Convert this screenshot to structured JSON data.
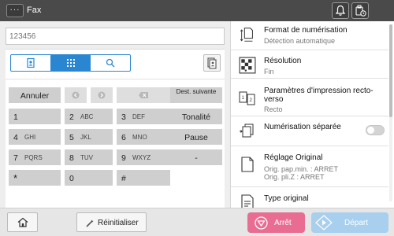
{
  "header": {
    "menu_label": "···",
    "title": "Fax",
    "icons": [
      "bell-icon",
      "device-status-icon"
    ]
  },
  "destination": {
    "value": "123456",
    "tabs": [
      "address-book-icon",
      "keypad-icon",
      "search-icon"
    ],
    "active_tab": "keypad-icon",
    "book_icon": "address-book-icon"
  },
  "keypad": {
    "cancel": "Annuler",
    "dest_next": "Dest. suivante",
    "keys": [
      {
        "num": "1",
        "letters": ""
      },
      {
        "num": "2",
        "letters": "ABC"
      },
      {
        "num": "3",
        "letters": "DEF"
      },
      {
        "num": "4",
        "letters": "GHI"
      },
      {
        "num": "5",
        "letters": "JKL"
      },
      {
        "num": "6",
        "letters": "MNO"
      },
      {
        "num": "7",
        "letters": "PQRS"
      },
      {
        "num": "8",
        "letters": "TUV"
      },
      {
        "num": "9",
        "letters": "WXYZ"
      },
      {
        "num": "*",
        "letters": ""
      },
      {
        "num": "0",
        "letters": ""
      },
      {
        "num": "#",
        "letters": ""
      }
    ],
    "tone": "Tonalité",
    "pause": "Pause",
    "dash": "-"
  },
  "settings": [
    {
      "title": "Format de numérisation",
      "subtitle": "Détection automatique",
      "icon": "scan-size-icon"
    },
    {
      "title": "Résolution",
      "subtitle": "Fin",
      "icon": "resolution-icon"
    },
    {
      "title": "Paramètres d'impression recto-verso",
      "subtitle": "Recto",
      "icon": "duplex-icon"
    },
    {
      "title": "Numérisation séparée",
      "subtitle": "",
      "icon": "separate-scan-icon",
      "toggle": false
    },
    {
      "title": "Réglage Original",
      "subtitle": "Orig. pap.min. : ARRET",
      "subtitle2": "Orig. pli.Z : ARRET",
      "icon": "original-settings-icon"
    },
    {
      "title": "Type original",
      "subtitle": "",
      "icon": "original-type-icon"
    }
  ],
  "footer": {
    "reset": "Réinitialiser",
    "stop": "Arrêt",
    "start": "Départ"
  },
  "colors": {
    "header": "#4a4a4a",
    "accent": "#2a86d1",
    "stop": "#e96d93",
    "start": "#a8cfee"
  }
}
